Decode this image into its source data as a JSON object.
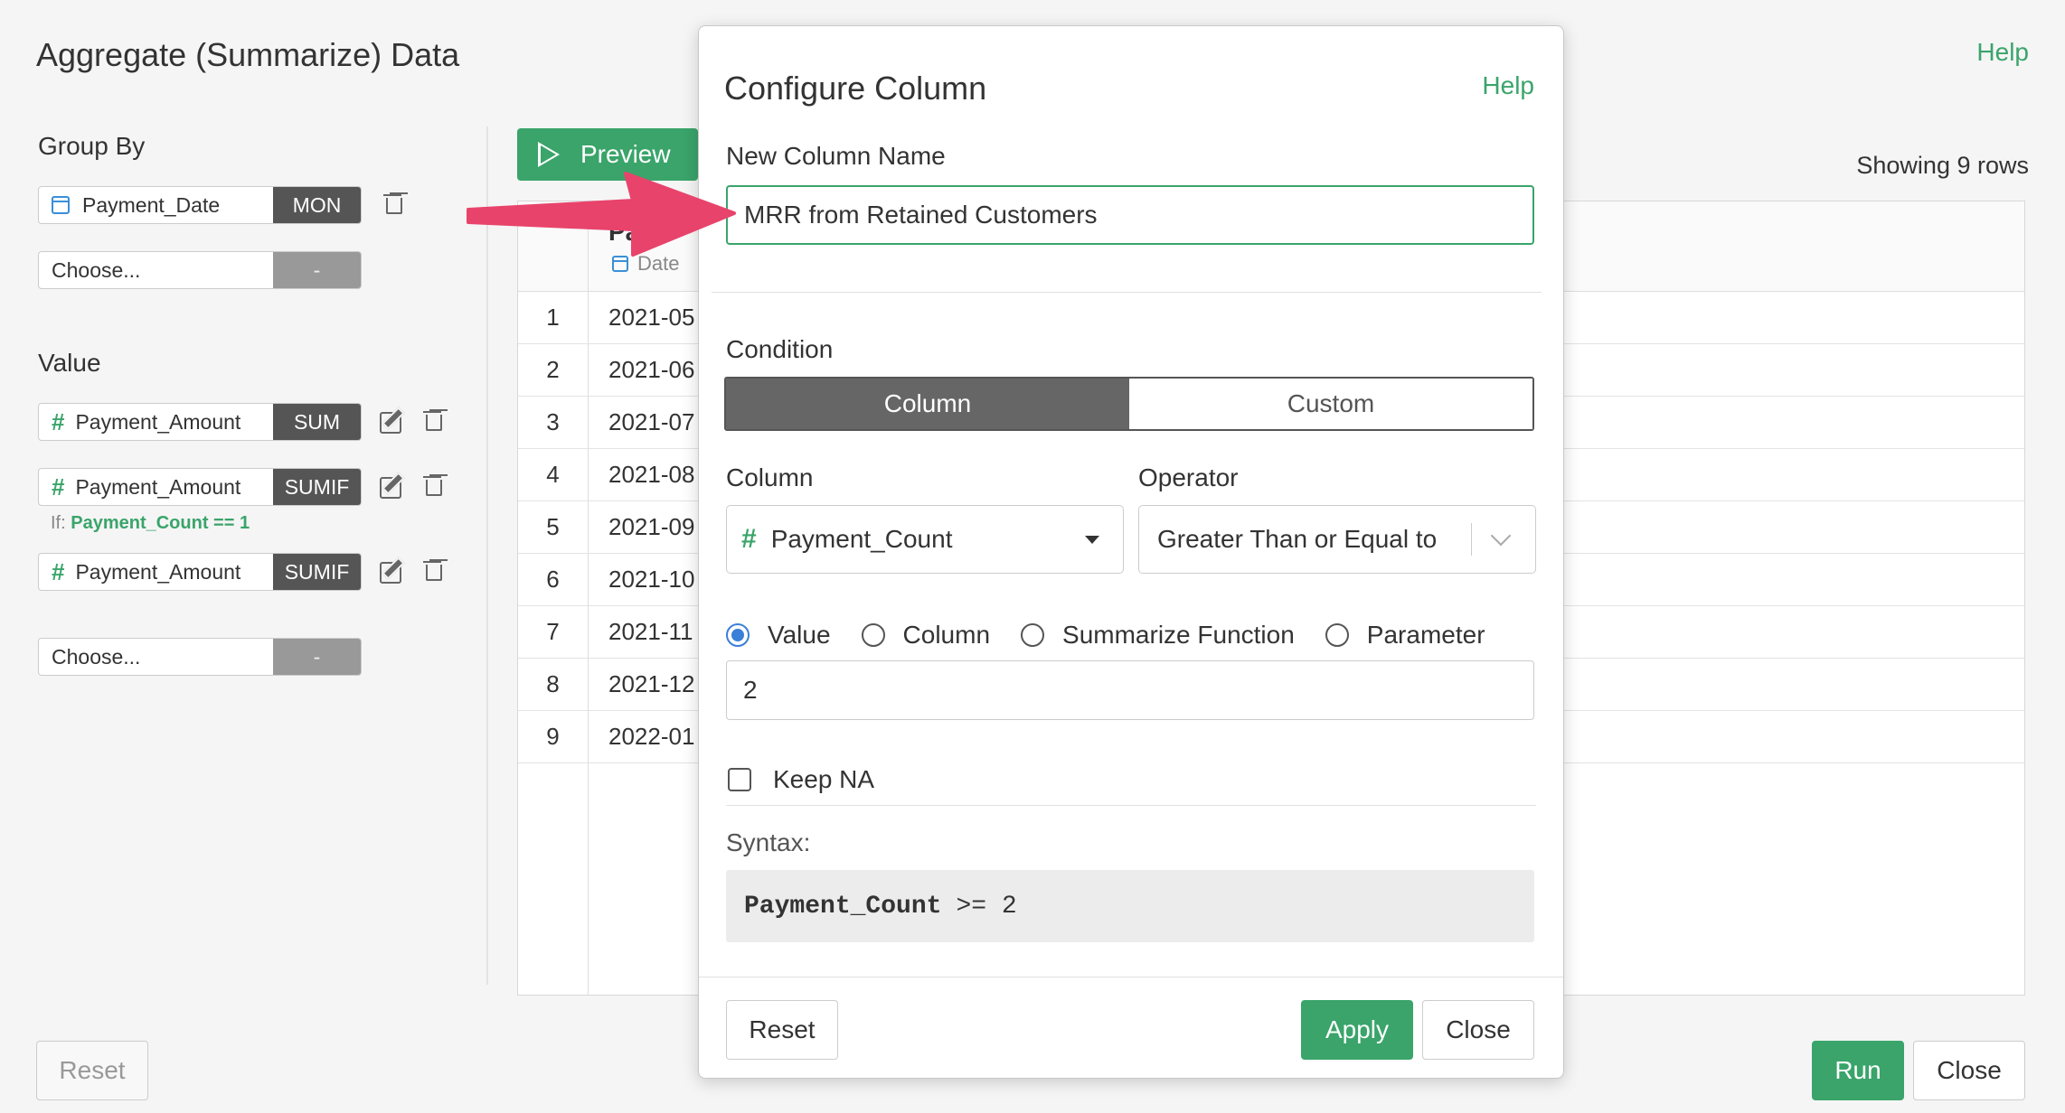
{
  "page": {
    "title": "Aggregate (Summarize) Data",
    "help": "Help",
    "showing": "Showing 9 rows"
  },
  "group_by": {
    "label": "Group By",
    "items": [
      {
        "icon": "calendar-icon",
        "name": "Payment_Date",
        "tag": "MON"
      },
      {
        "icon": "",
        "name": "Choose...",
        "tag": "-"
      }
    ]
  },
  "value": {
    "label": "Value",
    "items": [
      {
        "icon": "hash-icon",
        "name": "Payment_Amount",
        "tag": "SUM"
      },
      {
        "icon": "hash-icon",
        "name": "Payment_Amount",
        "tag": "SUMIF",
        "condition_prefix": "If:",
        "condition": "Payment_Count == 1"
      },
      {
        "icon": "hash-icon",
        "name": "Payment_Amount",
        "tag": "SUMIF"
      },
      {
        "icon": "",
        "name": "Choose...",
        "tag": "-"
      }
    ]
  },
  "toolbar": {
    "preview": "Preview"
  },
  "table": {
    "column_name": "Pay",
    "column_type": "Date",
    "rows": [
      {
        "n": "1",
        "v": "2021-05"
      },
      {
        "n": "2",
        "v": "2021-06"
      },
      {
        "n": "3",
        "v": "2021-07"
      },
      {
        "n": "4",
        "v": "2021-08"
      },
      {
        "n": "5",
        "v": "2021-09"
      },
      {
        "n": "6",
        "v": "2021-10"
      },
      {
        "n": "7",
        "v": "2021-11"
      },
      {
        "n": "8",
        "v": "2021-12"
      },
      {
        "n": "9",
        "v": "2022-01"
      }
    ]
  },
  "footer": {
    "reset": "Reset",
    "run": "Run",
    "close": "Close"
  },
  "modal": {
    "title": "Configure Column",
    "help": "Help",
    "new_column_label": "New Column Name",
    "new_column_value": "MRR from Retained Customers",
    "condition_label": "Condition",
    "tabs": [
      "Column",
      "Custom"
    ],
    "column_label": "Column",
    "column_value": "Payment_Count",
    "operator_label": "Operator",
    "operator_value": "Greater Than or Equal to",
    "radios": [
      "Value",
      "Column",
      "Summarize Function",
      "Parameter"
    ],
    "value_input": "2",
    "keep_na": "Keep NA",
    "syntax_label": "Syntax:",
    "syntax_column": "Payment_Count",
    "syntax_rest": ">= 2",
    "reset": "Reset",
    "apply": "Apply",
    "close": "Close"
  },
  "colors": {
    "accent_green": "#3aa46a",
    "arrow_pink": "#e8436b",
    "tag_dark": "#555555"
  }
}
